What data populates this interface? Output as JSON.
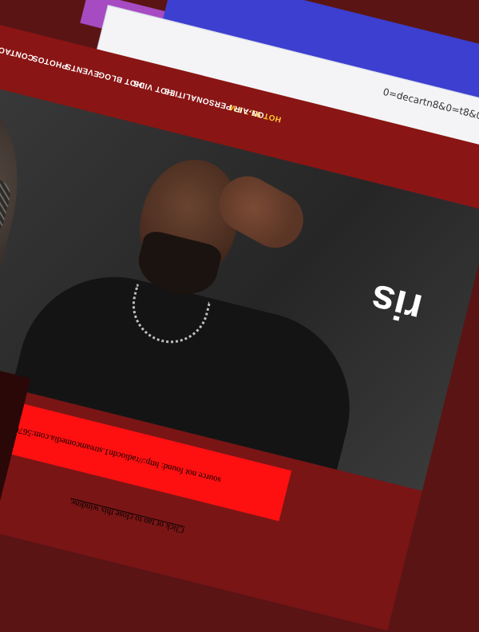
{
  "browser": {
    "url_fragment": "0=bǝbɐɹʇ8&0=biɈɹɐɔ7",
    "url_display": "0=decartn8&0=t8&0=7carttd=0"
  },
  "nav": {
    "items": [
      {
        "label": "HOT 91.7 FM",
        "active": true
      },
      {
        "label": "ON-AIR PERSONALITIES",
        "active": false
      },
      {
        "label": "HOT VIDS",
        "active": false
      },
      {
        "label": "HOT BLOG",
        "active": false
      },
      {
        "label": "EVENTS",
        "active": false
      },
      {
        "label": "PHOTOS",
        "active": false
      },
      {
        "label": "CONTACT",
        "active": false
      }
    ]
  },
  "hero": {
    "text": "ris"
  },
  "player": {
    "controls": [
      "↻",
      "↯",
      "⟲",
      "☐"
    ],
    "error_line1": "source not found: http://radiocdn1.streamcomedia.com:5670/hot917fm",
    "error_line2": "Click or tap to close this window."
  },
  "colors": {
    "nav_bg": "#8a1515",
    "active_nav": "#ffcc33",
    "error_bg": "#ff1010"
  }
}
